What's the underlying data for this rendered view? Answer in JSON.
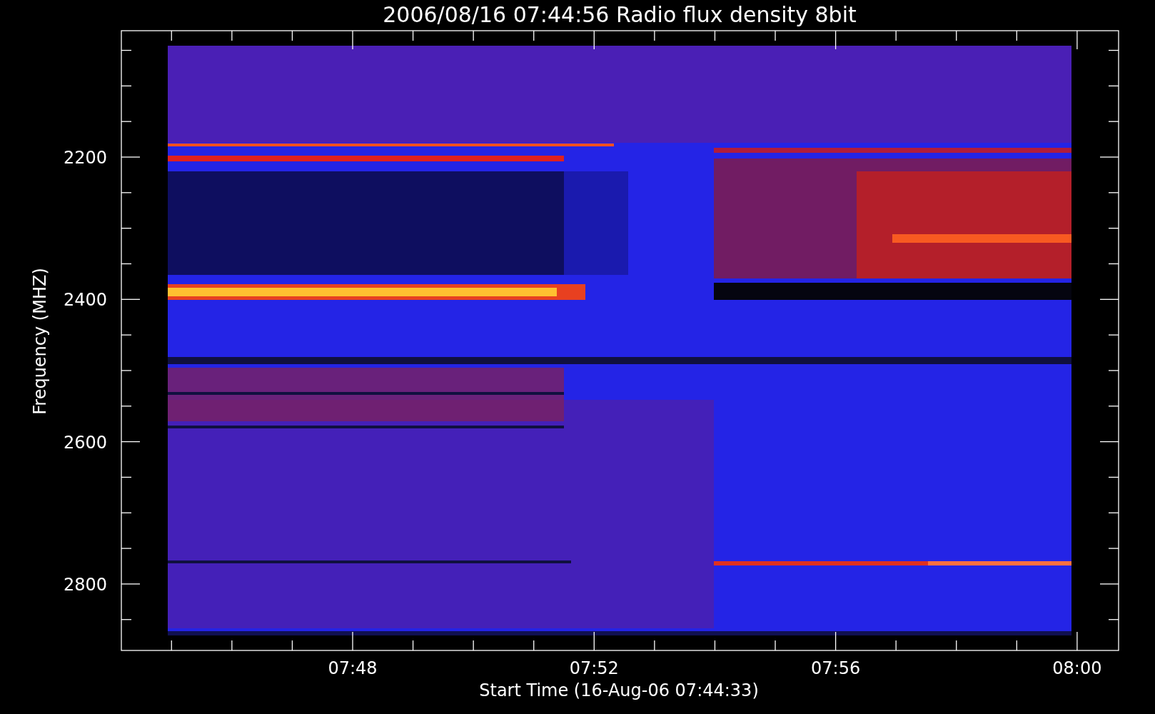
{
  "plot": {
    "title": "2006/08/16 07:44:56 Radio flux density 8bit",
    "ylabel": "Frequency (MHZ)",
    "xlabel": "Start Time (16-Aug-06 07:44:33)",
    "yticks": [
      "2200",
      "2400",
      "2600",
      "2800"
    ],
    "xticks": [
      "07:48",
      "07:52",
      "07:56",
      "08:00"
    ]
  }
}
